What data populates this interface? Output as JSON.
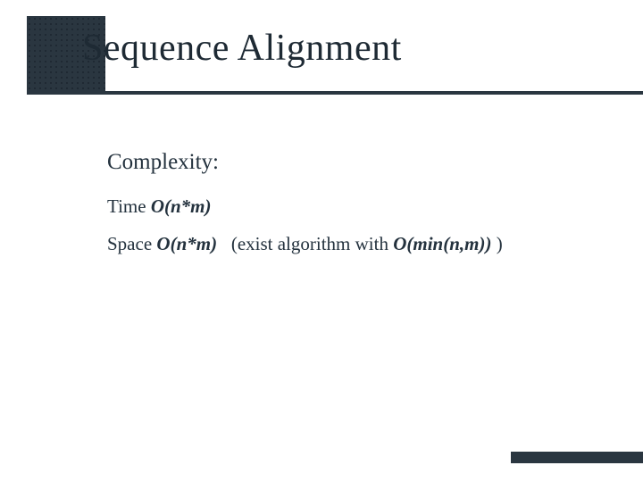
{
  "title": "Sequence Alignment",
  "body": {
    "heading": "Complexity:",
    "time_label": "Time ",
    "time_big_o": "O(n*m)",
    "space_label": "Space ",
    "space_big_o": "O(n*m)",
    "space_note_prefix": "   (exist algorithm with ",
    "space_note_big_o": "O(min(n,m))",
    "space_note_suffix": " )"
  }
}
